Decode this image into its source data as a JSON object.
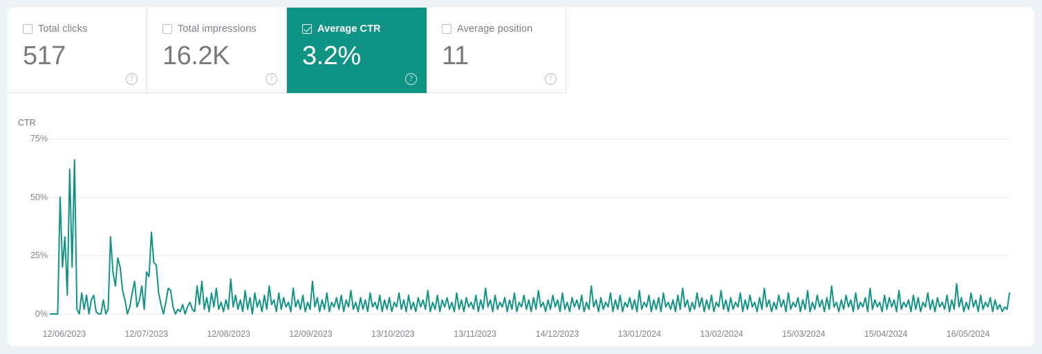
{
  "theme": {
    "page_background": "#eef1f5",
    "panel_background": "#ffffff",
    "accent": "#0f9384",
    "line_color": "#0f9384",
    "muted_text": "#7a7f87",
    "grid_color": "#e8e9ea"
  },
  "metrics": [
    {
      "id": "total-clicks",
      "label": "Total clicks",
      "value": "517",
      "checked": false,
      "help": "?"
    },
    {
      "id": "total-impressions",
      "label": "Total impressions",
      "value": "16.2K",
      "checked": false,
      "help": "?"
    },
    {
      "id": "average-ctr",
      "label": "Average CTR",
      "value": "3.2%",
      "checked": true,
      "help": "?"
    },
    {
      "id": "average-position",
      "label": "Average position",
      "value": "11",
      "checked": false,
      "help": "?"
    }
  ],
  "chart_data": {
    "type": "line",
    "title": "CTR",
    "xlabel": "",
    "ylabel": "CTR",
    "ylim": [
      0,
      75
    ],
    "yticks": [
      75,
      50,
      25,
      0
    ],
    "ytick_labels": [
      "75%",
      "50%",
      "25%",
      "0%"
    ],
    "grid": true,
    "legend": null,
    "xtick_labels": [
      "12/06/2023",
      "12/07/2023",
      "12/08/2023",
      "12/09/2023",
      "13/10/2023",
      "13/11/2023",
      "14/12/2023",
      "13/01/2024",
      "13/02/2024",
      "15/03/2024",
      "15/04/2024",
      "16/05/2024"
    ],
    "series": [
      {
        "name": "Average CTR",
        "color": "#0f9384",
        "unit": "%",
        "values": [
          0,
          0,
          0,
          0,
          50,
          20,
          33,
          8,
          62,
          20,
          66,
          2,
          0,
          9,
          2,
          8,
          0,
          6,
          8,
          1,
          0,
          0,
          6,
          0,
          2,
          33,
          18,
          12,
          24,
          20,
          10,
          6,
          0,
          3,
          9,
          14,
          3,
          6,
          12,
          2,
          18,
          16,
          35,
          22,
          21,
          9,
          4,
          0,
          5,
          11,
          10,
          3,
          0,
          2,
          1,
          4,
          0,
          3,
          5,
          2,
          1,
          12,
          4,
          14,
          2,
          7,
          1,
          9,
          3,
          11,
          2,
          5,
          1,
          6,
          2,
          15,
          3,
          8,
          2,
          6,
          1,
          10,
          2,
          7,
          0,
          9,
          3,
          6,
          1,
          8,
          2,
          12,
          4,
          6,
          1,
          9,
          2,
          7,
          3,
          5,
          1,
          11,
          3,
          6,
          2,
          8,
          1,
          5,
          2,
          14,
          3,
          7,
          1,
          6,
          2,
          9,
          1,
          5,
          3,
          7,
          2,
          8,
          1,
          6,
          3,
          10,
          2,
          5,
          1,
          7,
          2,
          6,
          1,
          9,
          3,
          5,
          2,
          8,
          1,
          6,
          2,
          7,
          1,
          5,
          3,
          9,
          2,
          6,
          1,
          8,
          2,
          5,
          1,
          7,
          3,
          6,
          2,
          10,
          1,
          5,
          2,
          8,
          1,
          6,
          3,
          7,
          2,
          5,
          1,
          9,
          2,
          6,
          1,
          7,
          3,
          5,
          2,
          8,
          1,
          6,
          2,
          11,
          3,
          6,
          1,
          8,
          2,
          5,
          3,
          7,
          1,
          6,
          2,
          9,
          1,
          5,
          3,
          8,
          2,
          6,
          1,
          7,
          2,
          10,
          3,
          5,
          1,
          6,
          2,
          8,
          3,
          6,
          1,
          9,
          2,
          5,
          1,
          7,
          3,
          6,
          2,
          8,
          1,
          5,
          2,
          12,
          3,
          6,
          1,
          7,
          2,
          5,
          3,
          9,
          1,
          6,
          2,
          8,
          1,
          5,
          3,
          7,
          2,
          6,
          1,
          10,
          2,
          5,
          3,
          8,
          1,
          6,
          2,
          7,
          1,
          9,
          3,
          5,
          2,
          6,
          1,
          8,
          2,
          11,
          3,
          6,
          1,
          5,
          2,
          9,
          3,
          7,
          1,
          6,
          2,
          8,
          1,
          5,
          3,
          10,
          2,
          6,
          1,
          7,
          2,
          5,
          3,
          9,
          1,
          6,
          2,
          8,
          3,
          5,
          1,
          7,
          2,
          11,
          3,
          6,
          1,
          5,
          2,
          8,
          3,
          6,
          1,
          9,
          2,
          5,
          3,
          7,
          1,
          6,
          2,
          10,
          1,
          5,
          2,
          8,
          3,
          6,
          1,
          7,
          2,
          12,
          3,
          5,
          1,
          6,
          2,
          8,
          3,
          6,
          1,
          9,
          2,
          5,
          3,
          7,
          1,
          11,
          2,
          6,
          3,
          5,
          1,
          8,
          2,
          7,
          3,
          6,
          1,
          10,
          2,
          5,
          3,
          6,
          1,
          8,
          2,
          7,
          1,
          5,
          3,
          9,
          2,
          6,
          1,
          7,
          3,
          5,
          2,
          8,
          1,
          6,
          2,
          13,
          3,
          7,
          1,
          5,
          2,
          9,
          3,
          6,
          1,
          8,
          2,
          5,
          3,
          7,
          1,
          6,
          2,
          4,
          1,
          3,
          2,
          9
        ]
      }
    ]
  }
}
